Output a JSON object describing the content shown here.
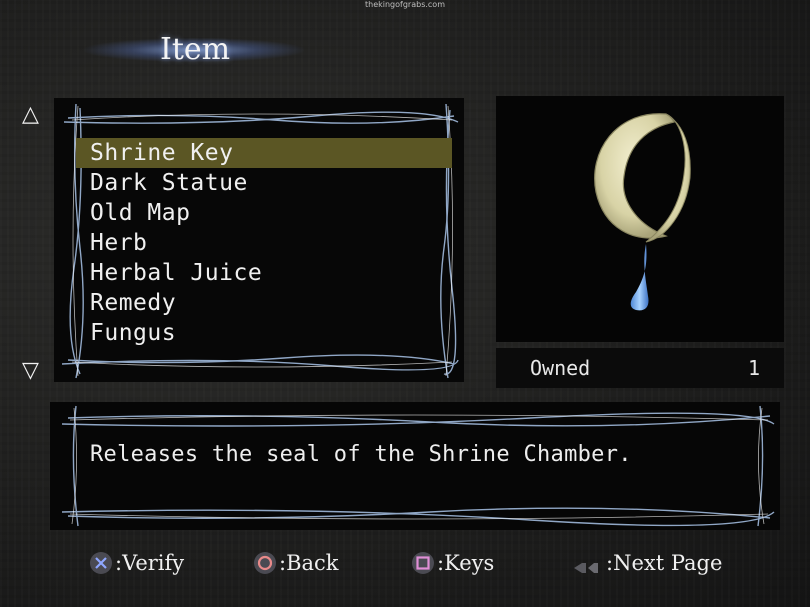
{
  "watermark": "thekingofgrabs.com",
  "header": {
    "title": "Item"
  },
  "nav": {
    "up_icon": "triangle-up-icon",
    "down_icon": "triangle-down-icon"
  },
  "items": [
    {
      "label": "Shrine Key",
      "selected": true
    },
    {
      "label": "Dark Statue",
      "selected": false
    },
    {
      "label": "Old Map",
      "selected": false
    },
    {
      "label": "Herb",
      "selected": false
    },
    {
      "label": "Herbal Juice",
      "selected": false
    },
    {
      "label": "Remedy",
      "selected": false
    },
    {
      "label": "Fungus",
      "selected": false
    }
  ],
  "preview": {
    "icon": "crescent-moon-key-icon"
  },
  "owned": {
    "label": "Owned",
    "count": "1"
  },
  "description": {
    "text": "Releases the seal of the Shrine Chamber."
  },
  "controls": {
    "verify": {
      "icon": "cross-button-icon",
      "label": ":Verify"
    },
    "back": {
      "icon": "circle-button-icon",
      "label": ":Back"
    },
    "keys": {
      "icon": "square-button-icon",
      "label": ":Keys"
    },
    "next_page": {
      "icon": "shoulder-buttons-icon",
      "label": ":Next Page"
    }
  },
  "colors": {
    "selection": "#5b5624",
    "wire": "#a9c4e8",
    "cross": "#8fa7ff",
    "circle": "#e88a8a",
    "square": "#e08fd6"
  }
}
